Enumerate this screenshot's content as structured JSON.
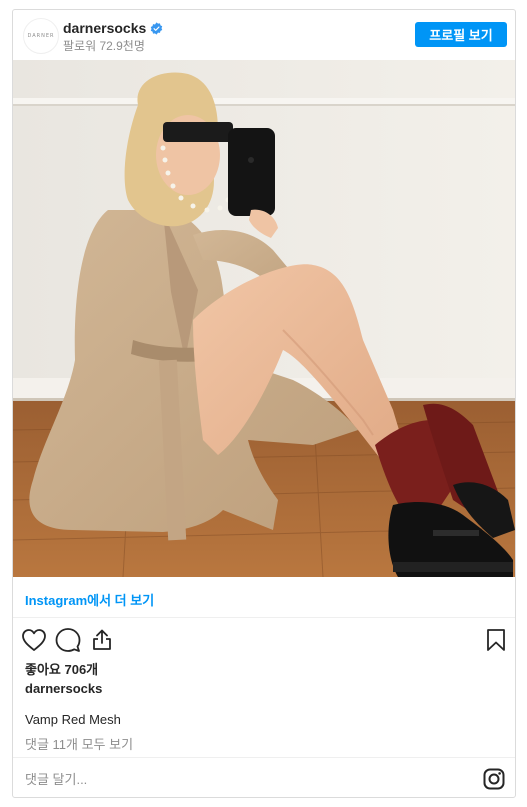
{
  "header": {
    "avatar_text": "DARNER",
    "username": "darnersocks",
    "followers": "팔로워 72.9천명",
    "profile_button": "프로필 보기"
  },
  "photo": {
    "alt": "Woman in trench coat with red mesh socks taking mirror selfie"
  },
  "view_more": "Instagram에서 더 보기",
  "likes": "좋아요 706개",
  "owner": "darnersocks",
  "caption": "Vamp Red Mesh",
  "comments_link": "댓글 11개 모두 보기",
  "comment_placeholder": "댓글 달기...",
  "colors": {
    "accent": "#0095f6",
    "text": "#262626",
    "muted": "#8e8e8e",
    "border": "#dbdbdb"
  },
  "icons": [
    "verified-badge-icon",
    "heart-icon",
    "comment-icon",
    "share-icon",
    "bookmark-icon",
    "instagram-logo-icon"
  ]
}
